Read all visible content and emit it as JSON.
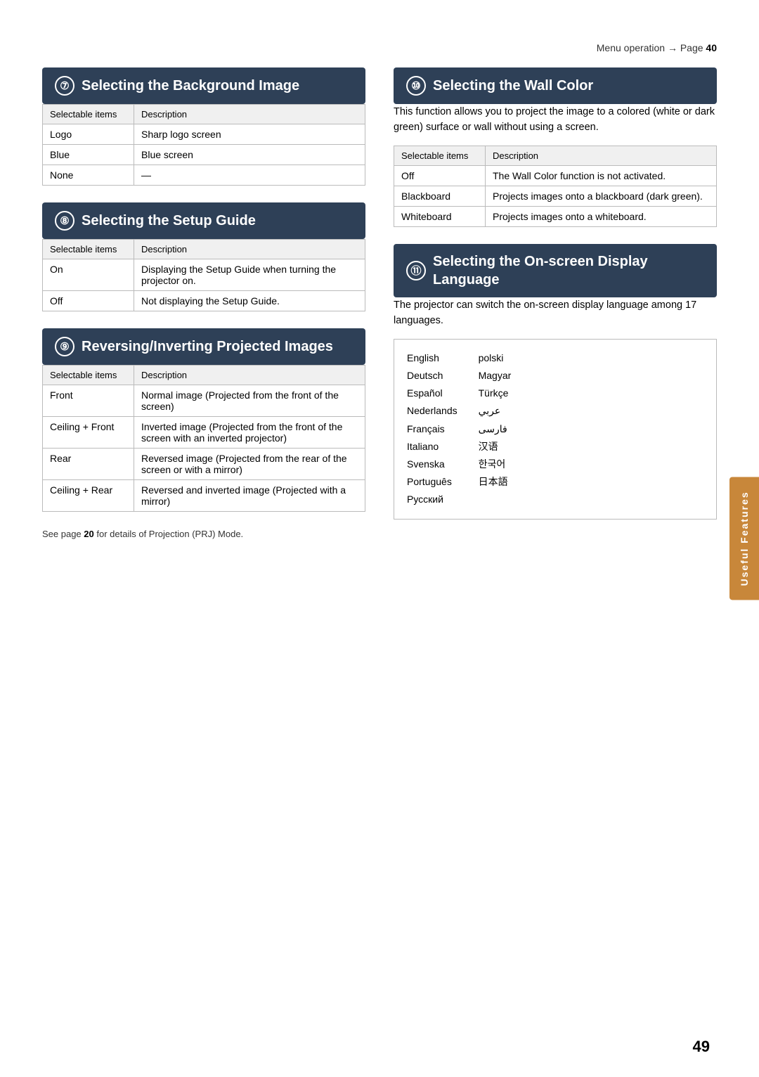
{
  "sidebar": {
    "label": "Useful Features"
  },
  "page_number": "49",
  "menu_operation": {
    "text": "Menu operation → Page",
    "page": "40"
  },
  "sections": {
    "section7": {
      "number": "7",
      "title": "Selecting the Background Image",
      "table_headers": [
        "Selectable items",
        "Description"
      ],
      "rows": [
        [
          "Logo",
          "Sharp logo screen"
        ],
        [
          "Blue",
          "Blue screen"
        ],
        [
          "None",
          "—"
        ]
      ]
    },
    "section8": {
      "number": "8",
      "title": "Selecting the Setup Guide",
      "table_headers": [
        "Selectable items",
        "Description"
      ],
      "rows": [
        [
          "On",
          "Displaying the Setup Guide when turning the projector on."
        ],
        [
          "Off",
          "Not displaying the Setup Guide."
        ]
      ]
    },
    "section9": {
      "number": "9",
      "title": "Reversing/Inverting Projected Images",
      "table_headers": [
        "Selectable items",
        "Description"
      ],
      "rows": [
        [
          "Front",
          "Normal image (Projected from the front of the screen)"
        ],
        [
          "Ceiling + Front",
          "Inverted image (Projected from the front of the screen with an inverted projector)"
        ],
        [
          "Rear",
          "Reversed image (Projected from the rear of the screen or with a mirror)"
        ],
        [
          "Ceiling + Rear",
          "Reversed and inverted image (Projected with a mirror)"
        ]
      ],
      "footer": "See page 20 for details of Projection (PRJ) Mode."
    },
    "section10": {
      "number": "10",
      "title": "Selecting the Wall Color",
      "description": "This function allows you to project the image to a colored (white or dark green) surface or wall without using a screen.",
      "table_headers": [
        "Selectable items",
        "Description"
      ],
      "rows": [
        [
          "Off",
          "The Wall Color function is not activated."
        ],
        [
          "Blackboard",
          "Projects images onto a blackboard (dark green)."
        ],
        [
          "Whiteboard",
          "Projects images onto a whiteboard."
        ]
      ]
    },
    "section11": {
      "number": "11",
      "title": "Selecting the On-screen Display Language",
      "description": "The projector can switch the on-screen display language among 17 languages.",
      "languages_col1": [
        "English",
        "Deutsch",
        "Español",
        "Nederlands",
        "Français",
        "Italiano",
        "Svenska",
        "Português",
        "Русский"
      ],
      "languages_col2": [
        "polski",
        "Magyar",
        "Türkçe",
        "عربي",
        "فارسی",
        "汉语",
        "한국어",
        "日本語"
      ]
    }
  }
}
